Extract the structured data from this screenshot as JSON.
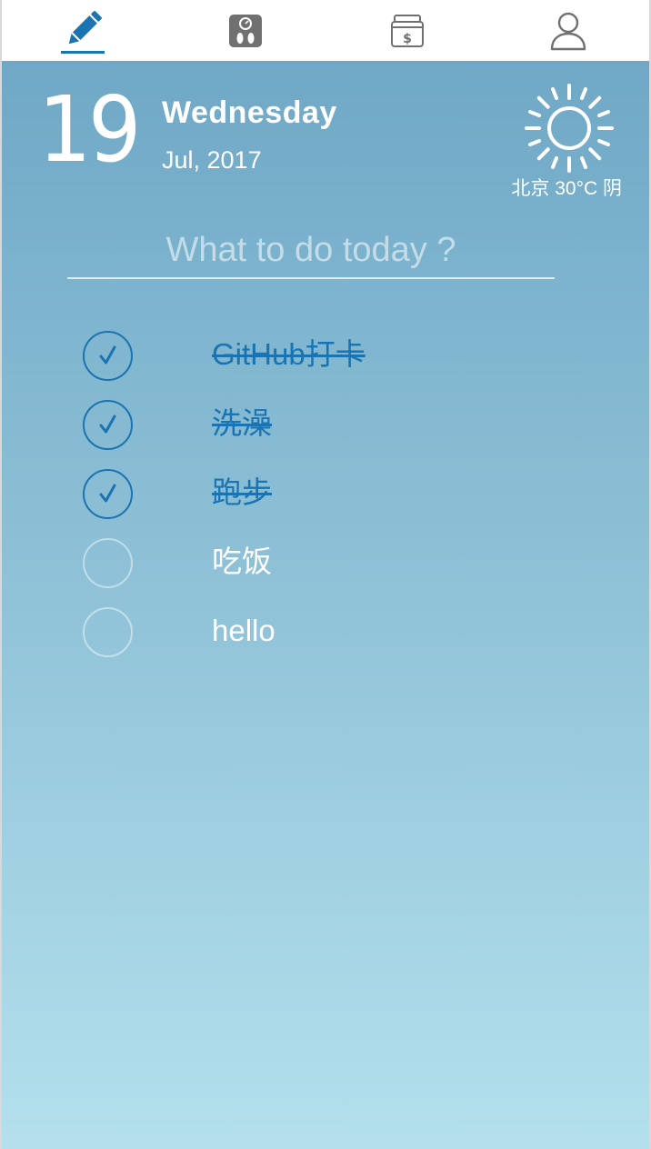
{
  "tabs": [
    {
      "icon": "pencil-icon",
      "active": true
    },
    {
      "icon": "scale-icon",
      "active": false
    },
    {
      "icon": "money-box-icon",
      "active": false
    },
    {
      "icon": "user-icon",
      "active": false
    }
  ],
  "date": {
    "day": "19",
    "weekday": "Wednesday",
    "month_year": "Jul, 2017"
  },
  "weather": {
    "icon": "sun-icon",
    "text": "北京 30°C 阴"
  },
  "input": {
    "placeholder": "What to do today ?",
    "value": ""
  },
  "todos": [
    {
      "text": "GitHub打卡",
      "done": true
    },
    {
      "text": "洗澡",
      "done": true
    },
    {
      "text": "跑步",
      "done": true
    },
    {
      "text": "吃饭",
      "done": false
    },
    {
      "text": "hello",
      "done": false
    }
  ],
  "colors": {
    "accent": "#1a74b2",
    "gradient_top": "#6fa8c6",
    "gradient_bottom": "#b4e0ed"
  }
}
